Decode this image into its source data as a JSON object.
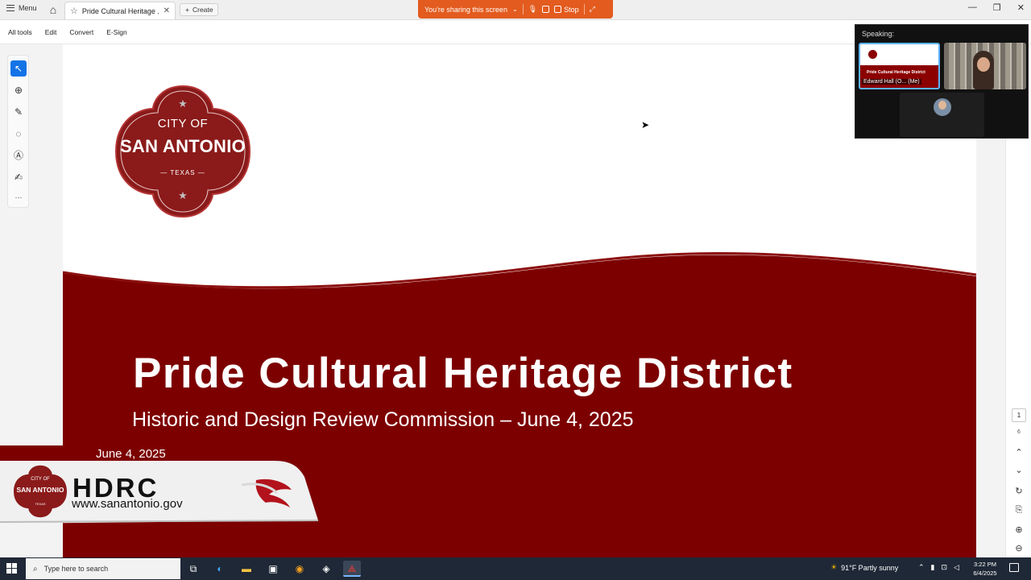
{
  "titlebar": {
    "menu_label": "Menu",
    "tab_title": "Pride Cultural Heritage ..",
    "create_label": "Create",
    "share_text": "You're sharing this screen",
    "stop_label": "Stop"
  },
  "toolbar": {
    "items": [
      "All tools",
      "Edit",
      "Convert",
      "E-Sign"
    ]
  },
  "slide": {
    "seal_city_of": "CITY OF",
    "seal_name": "SAN ANTONIO",
    "seal_state": "— TEXAS —",
    "title": "Pride Cultural Heritage District",
    "subtitle": "Historic and Design Review Commission – June 4, 2025"
  },
  "lower_third": {
    "date": "June 4, 2025",
    "org": "HDRC",
    "url": "www.sanantonio.gov",
    "seal_city_of": "CITY OF",
    "seal_name": "SAN ANTONIO",
    "seal_state": "TEXAS"
  },
  "page_nav": {
    "current_page": "1",
    "total_pages": "6"
  },
  "meeting": {
    "speaking_label": "Speaking:",
    "tile_title": "Pride Cultural Heritage District",
    "self_name": "Edward Hall (O... (Me)"
  },
  "taskbar": {
    "search_placeholder": "Type here to search",
    "weather": "91°F  Partly sunny",
    "time": "3:22 PM",
    "date": "6/4/2025"
  },
  "colors": {
    "brand_red": "#7d0000",
    "share_orange": "#e35b1e",
    "taskbar": "#1f2836"
  }
}
